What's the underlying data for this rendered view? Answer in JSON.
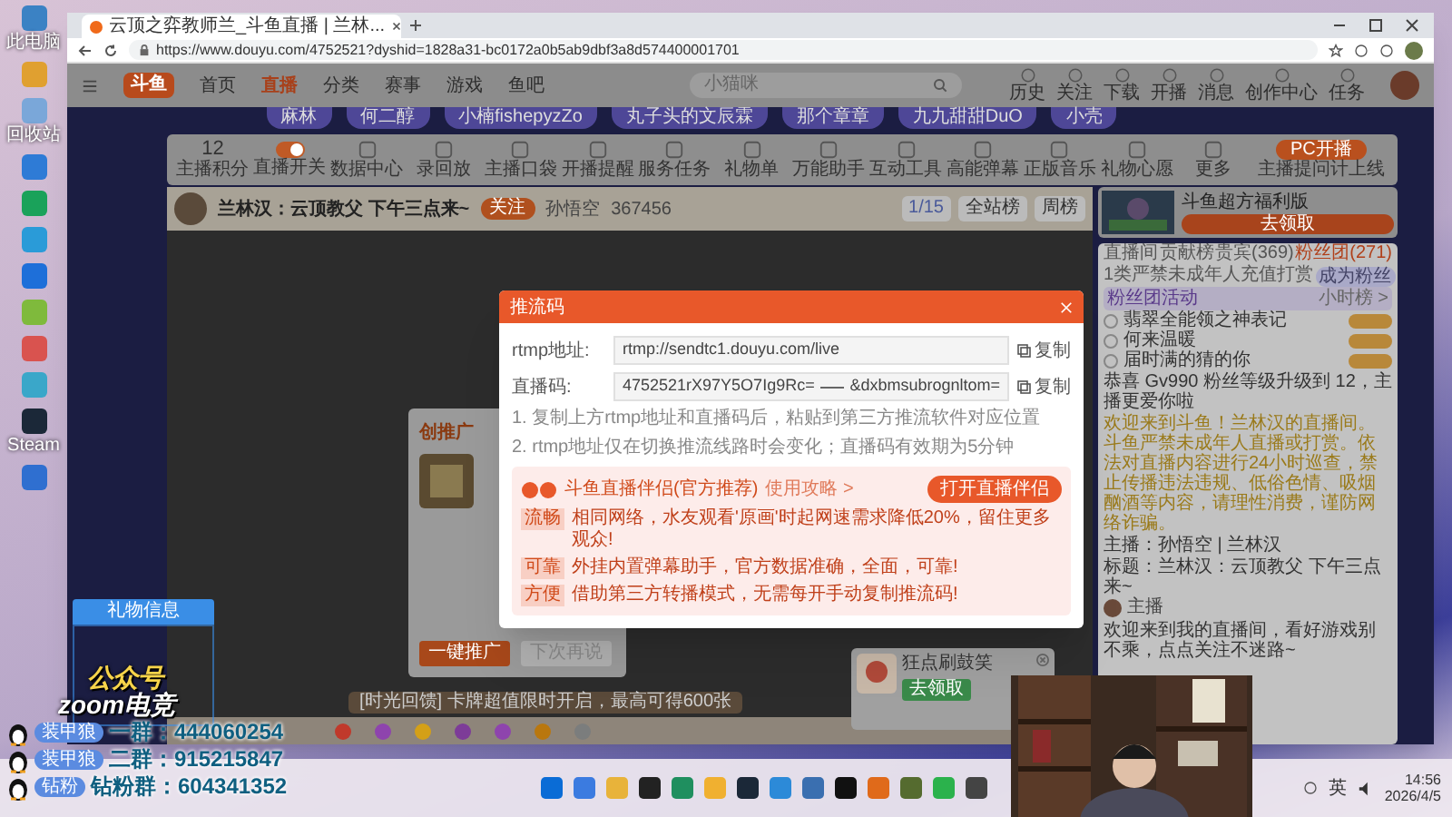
{
  "desktop_icons": [
    {
      "label": "此电脑",
      "color": "#3b82c4"
    },
    {
      "color": "#e0a030"
    },
    {
      "label": "回收站",
      "color": "#7aa7d9"
    },
    {
      "color": "#2e7bd6"
    },
    {
      "color": "#1aa25a"
    },
    {
      "color": "#2a9bd8"
    },
    {
      "color": "#1e6fd9"
    },
    {
      "color": "#7fba3c"
    },
    {
      "color": "#d9534f"
    },
    {
      "color": "#3aa7c9"
    },
    {
      "label": "Steam",
      "color": "#1b2838"
    },
    {
      "color": "#2f6fd0"
    }
  ],
  "browser": {
    "tab_title": "云顶之弈教师兰_斗鱼直播 | 兰林...",
    "url": "https://www.douyu.com/4752521?dyshid=1828a31-bc0172a0b5ab9dbf3a8d574400001701"
  },
  "site_nav": {
    "logo": "斗鱼",
    "items": [
      {
        "label": "首页",
        "selected": false
      },
      {
        "label": "直播",
        "selected": true
      },
      {
        "label": "分类",
        "selected": false
      },
      {
        "label": "赛事",
        "selected": false
      },
      {
        "label": "游戏",
        "selected": false
      },
      {
        "label": "鱼吧",
        "selected": false
      }
    ],
    "search": {
      "placeholder": "小猫咪"
    },
    "actions": [
      "历史",
      "关注",
      "下载",
      "开播",
      "消息",
      "创作中心",
      "任务"
    ]
  },
  "recommended_streamers": [
    "麻林",
    "何二醇",
    "小楠fishepyzZo",
    "丸子头的文辰霖",
    "那个章章",
    "九九甜甜DuO",
    "小壳"
  ],
  "toolbar": {
    "items": [
      {
        "kind": "score",
        "value": "12",
        "label": "主播积分"
      },
      {
        "kind": "toggle",
        "label": "直播开关",
        "on": true
      },
      {
        "kind": "tool",
        "label": "数据中心"
      },
      {
        "kind": "tool",
        "label": "录回放"
      },
      {
        "kind": "tool",
        "label": "主播口袋"
      },
      {
        "kind": "tool",
        "label": "开播提醒"
      },
      {
        "kind": "tool",
        "label": "服务任务"
      },
      {
        "kind": "tool",
        "label": "礼物单"
      },
      {
        "kind": "tool",
        "label": "万能助手"
      },
      {
        "kind": "tool",
        "label": "互动工具"
      },
      {
        "kind": "tool",
        "label": "高能弹幕"
      },
      {
        "kind": "tool",
        "label": "正版音乐"
      },
      {
        "kind": "tool",
        "label": "礼物心愿"
      },
      {
        "kind": "tool",
        "label": "更多"
      }
    ],
    "pc_button": "PC开播",
    "pc_caption": "主播提问计上线"
  },
  "room": {
    "title": "兰林汉：云顶教父 下午三点来~",
    "follow": "关注",
    "anchor": "孙悟空",
    "heat": "367456",
    "rank": "1/15",
    "buttons": [
      "全站榜",
      "周榜"
    ]
  },
  "video": {
    "gift_tip": "[时光回馈] 卡牌超值限时开启，最高可得600张"
  },
  "stream_key_dialog": {
    "title": "推流码",
    "fields": [
      {
        "label": "rtmp地址:",
        "value": "rtmp://sendtc1.douyu.com/live",
        "action": "复制"
      },
      {
        "label": "直播码:",
        "value": "4752521rX97Y5O7Ig9Rc=",
        "value_end": "&dxbmsubrognltom=",
        "action": "复制"
      }
    ],
    "notes": [
      "1. 复制上方rtmp地址和直播码后，粘贴到第三方推流软件对应位置",
      "2. rtmp地址仅在切换推流线路时会变化；直播码有效期为5分钟"
    ],
    "promo": {
      "title": "斗鱼直播伴侣(官方推荐)",
      "link": "使用攻略 >",
      "button": "打开直播伴侣",
      "features": [
        {
          "tag": "流畅",
          "text": "相同网络，水友观看'原画'时起网速需求降低20%，留住更多观众!"
        },
        {
          "tag": "可靠",
          "text": "外挂内置弹幕助手，官方数据准确，全面，可靠!"
        },
        {
          "tag": "方便",
          "text": "借助第三方转播模式，无需每开手动复制推流码!"
        }
      ]
    }
  },
  "promo_dialog": {
    "title": "创推广",
    "buttons": [
      {
        "label": "一键推广",
        "disabled": false
      },
      {
        "label": "下次再说",
        "disabled": true
      }
    ]
  },
  "task_card": {
    "title": "狂点刷鼓笑",
    "button": "去领取"
  },
  "right_panel": {
    "ad": {
      "title": "斗鱼超方福利版",
      "button": "去领取"
    },
    "tabs": [
      {
        "label": "直播间",
        "selected": false
      },
      {
        "label": "贡献榜",
        "selected": false
      },
      {
        "label": "贵宾(369)",
        "selected": false
      },
      {
        "label": "粉丝团(271)",
        "selected": true
      }
    ],
    "fan_bar": {
      "text": "1类严禁未成年人充值打赏",
      "button": "成为粉丝"
    },
    "fan_club": {
      "title": "粉丝团活动",
      "link": "小时榜 >"
    },
    "ranks": [
      "翡翠全能领之神表记",
      "何来温暖",
      "届时满的猜的你"
    ],
    "messages": [
      {
        "kind": "system",
        "text": "恭喜 Gv990 粉丝等级升级到 12，主播更爱你啦"
      },
      {
        "kind": "notice",
        "text": "欢迎来到斗鱼！兰林汉的直播间。斗鱼严禁未成年人直播或打赏。依法对直播内容进行24小时巡查，禁止传播违法违规、低俗色情、吸烟酗酒等内容，请理性消费，谨防网络诈骗。"
      },
      {
        "kind": "info",
        "text": "主播：孙悟空 | 兰林汉"
      },
      {
        "kind": "info",
        "text": "标题：兰林汉：云顶教父 下午三点来~"
      },
      {
        "kind": "chat",
        "user": "主播",
        "text": "欢迎来到我的直播间，看好游戏别不乘，点点关注不迷路~"
      }
    ]
  },
  "gift_info": {
    "title": "礼物信息"
  },
  "stream_overlay": {
    "brand": "公众号",
    "channel": "zoom电竞",
    "groups": [
      {
        "badge": "装甲狼",
        "text": "一群：444060254"
      },
      {
        "badge": "装甲狼",
        "text": "二群：915215847"
      },
      {
        "badge": "钻粉",
        "text": "钻粉群：604341352"
      }
    ]
  },
  "taskbar": {
    "apps": [
      {
        "color": "#0a6cd6"
      },
      {
        "color": "#3b7be0"
      },
      {
        "color": "#e8b33a"
      },
      {
        "color": "#222222"
      },
      {
        "color": "#1f8f5f"
      },
      {
        "color": "#f0b030"
      },
      {
        "color": "#1b2838"
      },
      {
        "color": "#2c8ad8"
      },
      {
        "color": "#3a6fb0"
      },
      {
        "color": "#111111"
      },
      {
        "color": "#e06a1a"
      },
      {
        "color": "#556b2f"
      },
      {
        "color": "#2bb24c"
      },
      {
        "color": "#444444"
      }
    ],
    "ime": "英",
    "time": "14:56",
    "date": "2026/4/5"
  }
}
